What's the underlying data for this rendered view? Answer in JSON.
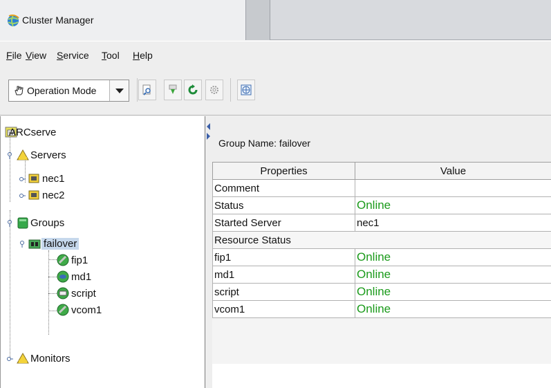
{
  "window": {
    "tab_title": "Cluster Manager",
    "tab_icon": "globe-icon"
  },
  "menu": {
    "items": [
      {
        "mnemonic": "F",
        "rest": "ile"
      },
      {
        "mnemonic": "V",
        "rest": "iew"
      },
      {
        "mnemonic": "S",
        "rest": "ervice"
      },
      {
        "mnemonic": "T",
        "rest": "ool"
      },
      {
        "mnemonic": "H",
        "rest": "elp"
      }
    ]
  },
  "toolbar": {
    "mode_select_value": "Operation Mode",
    "buttons": [
      "search-icon",
      "download-icon",
      "refresh-icon",
      "gear-icon",
      "grid-icon"
    ]
  },
  "tree": {
    "root": "ARCserve",
    "servers": "Servers",
    "server_items": [
      "nec1",
      "nec2"
    ],
    "groups": "Groups",
    "group_selected": "failover",
    "resources": [
      "fip1",
      "md1",
      "script",
      "vcom1"
    ],
    "monitors": "Monitors"
  },
  "details": {
    "group_name_label": "Group Name: failover",
    "columns": [
      "Properties",
      "Value"
    ],
    "rows": [
      {
        "property": "Comment",
        "value": ""
      },
      {
        "property": "Status",
        "value": "Online"
      },
      {
        "property": "Started Server",
        "value": "nec1"
      }
    ],
    "resource_section": "Resource Status",
    "resource_rows": [
      {
        "property": "fip1",
        "value": "Online"
      },
      {
        "property": "md1",
        "value": "Online"
      },
      {
        "property": "script",
        "value": "Online"
      },
      {
        "property": "vcom1",
        "value": "Online"
      }
    ]
  },
  "colors": {
    "online": "#1a9a1a",
    "selection": "#c6d8ec"
  }
}
